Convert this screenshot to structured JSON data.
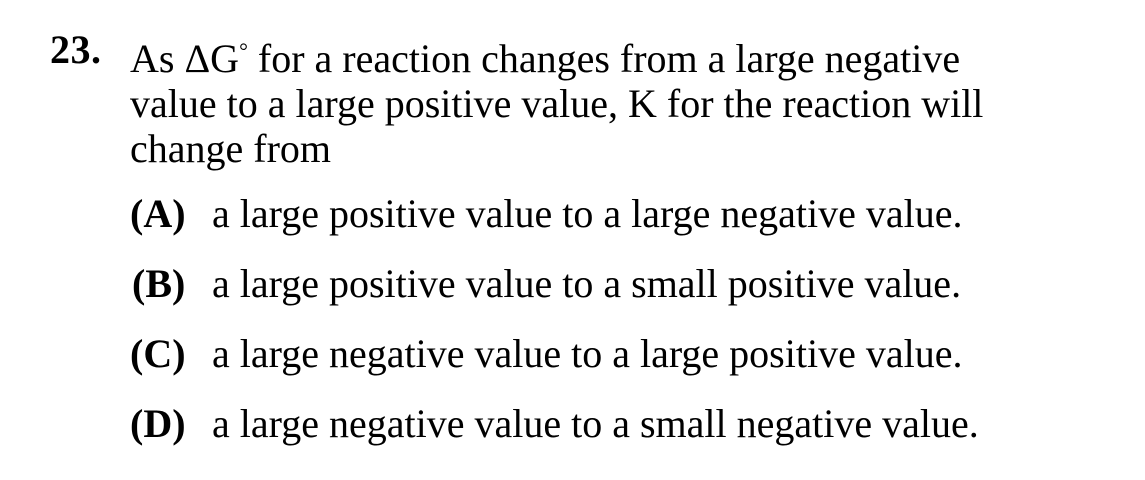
{
  "question": {
    "number": "23.",
    "stem_part1": "As ΔG",
    "degree_symbol": "°",
    "stem_part2": " for a reaction changes from a large negative",
    "stem_line2": "value to a large positive value, K for the reaction will",
    "stem_line3": "change from",
    "choices": [
      {
        "letter": "(A)",
        "text": "a large positive value to a large negative value."
      },
      {
        "letter": "(B)",
        "text": "a large positive value to a small positive value."
      },
      {
        "letter": "(C)",
        "text": "a large negative value to a large positive value."
      },
      {
        "letter": "(D)",
        "text": "a large negative value to a small negative value."
      }
    ]
  }
}
